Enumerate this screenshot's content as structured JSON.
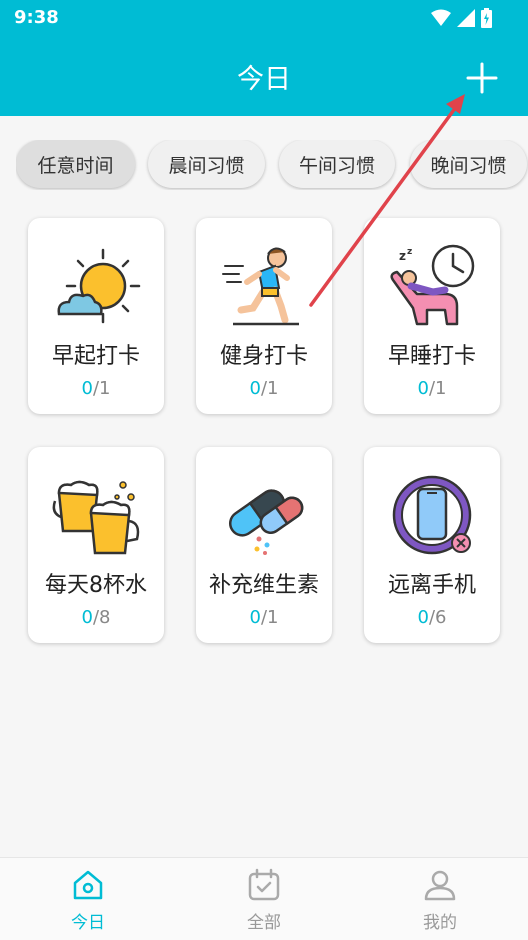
{
  "status_bar": {
    "time": "9:38"
  },
  "app_bar": {
    "title": "今日"
  },
  "filters": [
    {
      "label": "任意时间",
      "active": true
    },
    {
      "label": "晨间习惯",
      "active": false
    },
    {
      "label": "午间习惯",
      "active": false
    },
    {
      "label": "晚间习惯",
      "active": false
    }
  ],
  "habits": [
    {
      "title": "早起打卡",
      "done": "0",
      "total": "/1",
      "icon": "sun-cloud-icon"
    },
    {
      "title": "健身打卡",
      "done": "0",
      "total": "/1",
      "icon": "runner-icon"
    },
    {
      "title": "早睡打卡",
      "done": "0",
      "total": "/1",
      "icon": "sleep-clock-icon"
    },
    {
      "title": "每天8杯水",
      "done": "0",
      "total": "/8",
      "icon": "beer-mugs-icon"
    },
    {
      "title": "补充维生素",
      "done": "0",
      "total": "/1",
      "icon": "pills-icon"
    },
    {
      "title": "远离手机",
      "done": "0",
      "total": "/6",
      "icon": "phone-off-icon"
    }
  ],
  "bottom_nav": [
    {
      "label": "今日",
      "active": true
    },
    {
      "label": "全部",
      "active": false
    },
    {
      "label": "我的",
      "active": false
    }
  ],
  "colors": {
    "accent": "#00bcd4",
    "arrow": "#e0434b"
  }
}
